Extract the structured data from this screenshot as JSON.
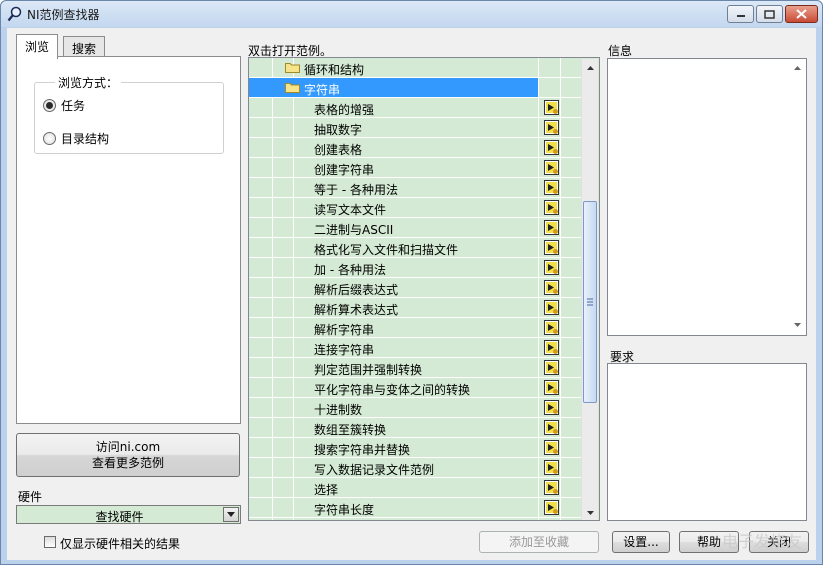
{
  "window": {
    "title": "NI范例查找器",
    "colors": {
      "tree_bg": "#d4ead4",
      "selection": "#3399ff"
    }
  },
  "tabs": [
    {
      "label": "浏览",
      "active": true
    },
    {
      "label": "搜索",
      "active": false
    }
  ],
  "browse": {
    "group_label": "浏览方式：",
    "options": [
      {
        "label": "任务",
        "selected": true
      },
      {
        "label": "目录结构",
        "selected": false
      }
    ]
  },
  "ni_button": {
    "line1": "访问ni.com",
    "line2": "查看更多范例"
  },
  "hardware": {
    "label": "硬件",
    "combo_value": "查找硬件"
  },
  "only_hw_checkbox": {
    "label": "仅显示硬件相关的结果",
    "checked": false
  },
  "tree": {
    "header": "双击打开范例。",
    "folders": [
      {
        "label": "循环和结构",
        "selected": false
      },
      {
        "label": "字符串",
        "selected": true
      }
    ],
    "items": [
      "表格的增强",
      "抽取数字",
      "创建表格",
      "创建字符串",
      "等于 - 各种用法",
      "读写文本文件",
      "二进制与ASCII",
      "格式化写入文件和扫描文件",
      "加 - 各种用法",
      "解析后缀表达式",
      "解析算术表达式",
      "解析字符串",
      "连接字符串",
      "判定范围并强制转换",
      "平化字符串与变体之间的转换",
      "十进制数",
      "数组至簇转换",
      "搜索字符串并替换",
      "写入数据记录文件范例",
      "选择",
      "字符串长度"
    ]
  },
  "info": {
    "label": "信息"
  },
  "requirements": {
    "label": "要求"
  },
  "buttons": {
    "add_favorite": "添加至收藏",
    "settings": "设置...",
    "help": "帮助",
    "close": "关闭"
  },
  "watermark": "电子发烧友"
}
